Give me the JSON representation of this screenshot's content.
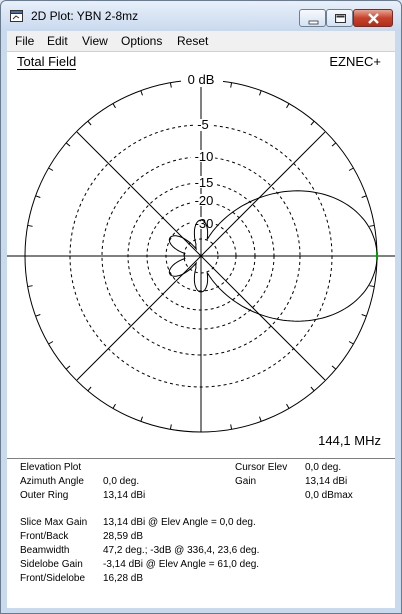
{
  "window": {
    "title": "2D Plot: YBN 2-8mz"
  },
  "menu": [
    "File",
    "Edit",
    "View",
    "Options",
    "Reset"
  ],
  "plot": {
    "title": "Total Field",
    "brand": "EZNEC+",
    "frequency": "144,1 MHz",
    "ring_labels": [
      "0 dB",
      "-5",
      "-10",
      "-15",
      "-20",
      "-30"
    ],
    "pattern_color": "#000000",
    "cursor_color": "#00a000"
  },
  "info": {
    "plot_type": "Elevation Plot",
    "azimuth_label": "Azimuth Angle",
    "azimuth_value": "0,0 deg.",
    "outer_ring_label": "Outer Ring",
    "outer_ring_value": "13,14 dBi",
    "cursor_elev_label": "Cursor Elev",
    "cursor_elev_value": "0,0 deg.",
    "gain_label": "Gain",
    "gain_value": "13,14 dBi",
    "gain_dbmax": "0,0 dBmax",
    "slice_max_label": "Slice Max Gain",
    "slice_max_value": "13,14 dBi @ Elev Angle = 0,0 deg.",
    "front_back_label": "Front/Back",
    "front_back_value": "28,59 dB",
    "beamwidth_label": "Beamwidth",
    "beamwidth_value": "47,2 deg.; -3dB @ 336,4, 23,6 deg.",
    "sidelobe_gain_label": "Sidelobe Gain",
    "sidelobe_gain_value": "-3,14 dBi @ Elev Angle = 61,0 deg.",
    "front_sidelobe_label": "Front/Sidelobe",
    "front_sidelobe_value": "16,28 dB"
  }
}
